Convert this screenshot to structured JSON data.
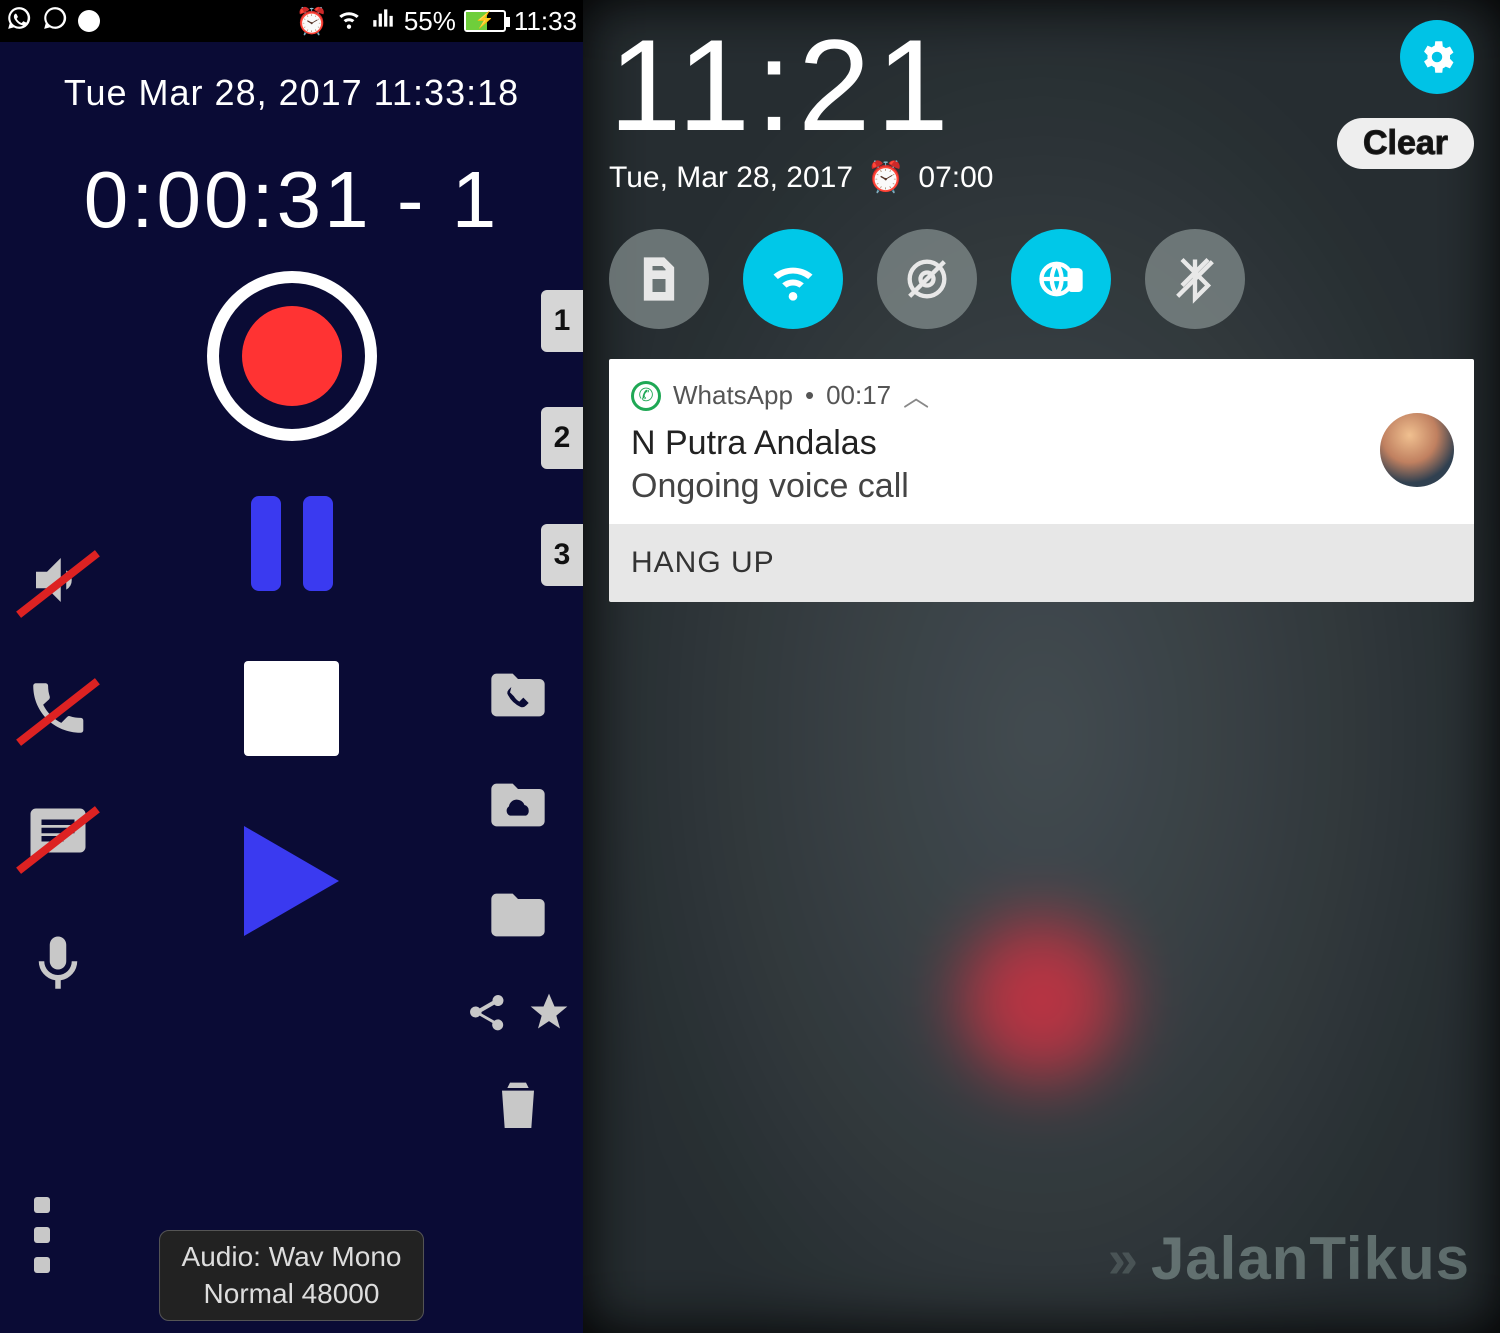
{
  "left": {
    "statusbar": {
      "battery_pct": "55%",
      "time": "11:33"
    },
    "datetime": "Tue Mar 28, 2017  11:33:18",
    "elapsed": "0:00:31 - 1",
    "tabs": [
      "1",
      "2",
      "3"
    ],
    "audio_line1": "Audio:  Wav  Mono",
    "audio_line2": "Normal   48000"
  },
  "right": {
    "clock": "11:21",
    "date": "Tue, Mar 28, 2017",
    "alarm": "07:00",
    "clear": "Clear",
    "notif": {
      "app": "WhatsApp",
      "duration": "00:17",
      "title": "N Putra Andalas",
      "subtitle": "Ongoing voice call",
      "action": "HANG UP"
    },
    "watermark": "JalanTikus"
  }
}
